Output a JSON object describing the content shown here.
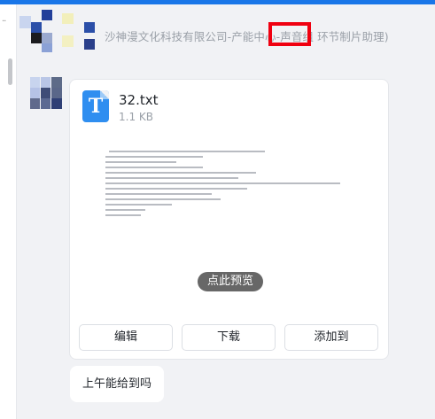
{
  "header": {
    "sender_info": "沙神漫文化科技有限公司-产能中心-声音组（环节制片助理）",
    "sender_info_visible": "沙神漫文化科技有限公司-产能中心-声音组 环节制片助理)"
  },
  "left_rail": {
    "more_label": "··"
  },
  "message_file": {
    "file_icon_letter": "T",
    "file_name": "32.txt",
    "file_size": "1.1 KB",
    "preview_label": "点此预览",
    "buttons": {
      "edit": "编辑",
      "download": "下载",
      "add_to": "添加到"
    }
  },
  "message_text": {
    "text": "上午能给到吗"
  },
  "colors": {
    "accent": "#1976e8",
    "highlight_box": "#f00010",
    "file_icon": "#2f8ef0"
  }
}
